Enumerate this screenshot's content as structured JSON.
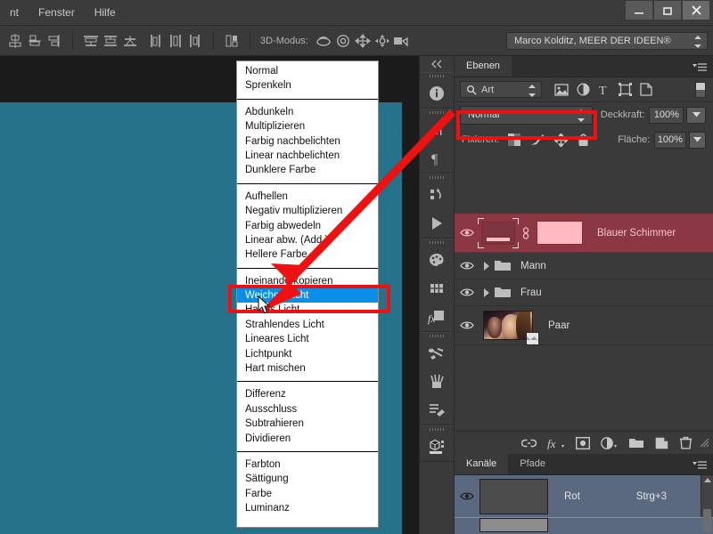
{
  "window": {
    "menu_items": [
      "nt",
      "Fenster",
      "Hilfe"
    ],
    "controls": {
      "minimize": "minimize-icon",
      "maximize": "maximize-icon",
      "close": "close-icon"
    }
  },
  "options_bar": {
    "align_icons": [
      "align-vertical-center-icon",
      "align-bottom-edges-icon",
      "distribute-top-edges-icon",
      "distribute-vertical-centers-icon",
      "distribute-bottom-edges-icon",
      "distribute-left-edges-icon",
      "distribute-horizontal-centers-icon",
      "distribute-right-edges-icon",
      "auto-align-layers-icon"
    ],
    "three_d_label": "3D-Modus:",
    "three_d_icons": [
      "orbit-3d-icon",
      "roll-3d-icon",
      "pan-3d-icon",
      "slide-3d-icon",
      "scale-3d-camera-icon"
    ],
    "preset_value": "Marco Kolditz, MEER DER IDEEN®"
  },
  "blend_dropdown": {
    "groups": [
      {
        "items": [
          "Normal",
          "Sprenkeln"
        ]
      },
      {
        "items": [
          "Abdunkeln",
          "Multiplizieren",
          "Farbig nachbelichten",
          "Linear nachbelichten",
          "Dunklere Farbe"
        ]
      },
      {
        "items": [
          "Aufhellen",
          "Negativ multiplizieren",
          "Farbig abwedeln",
          "Linear abw. (Add.)",
          "Hellere Farbe"
        ]
      },
      {
        "items": [
          "Ineinanderkopieren",
          "Weiches Licht",
          "Hartes Licht",
          "Strahlendes Licht",
          "Lineares Licht",
          "Lichtpunkt",
          "Hart mischen"
        ]
      },
      {
        "items": [
          "Differenz",
          "Ausschluss",
          "Subtrahieren",
          "Dividieren"
        ]
      },
      {
        "items": [
          "Farbton",
          "Sättigung",
          "Farbe",
          "Luminanz"
        ]
      }
    ],
    "highlighted": "Weiches Licht"
  },
  "dock": {
    "icons": [
      "collapse-panels-icon",
      "info-icon",
      "character-icon",
      "paragraph-icon",
      "layer-comps-icon",
      "timeline-icon",
      "color-icon",
      "swatches-icon",
      "styles-icon",
      "brush-presets-icon",
      "brushes-icon",
      "tool-presets-icon",
      "3d-icon"
    ]
  },
  "layers_panel": {
    "tabs": [
      {
        "label": "Ebenen",
        "active": true
      }
    ],
    "filter": {
      "search_icon": "search-icon",
      "kind_label": "Art",
      "type_filter_icons": [
        "pixel-filter-icon",
        "adjustment-filter-icon",
        "type-filter-icon",
        "shape-filter-icon",
        "smartobject-filter-icon"
      ],
      "toggle": "filter-enable-toggle"
    },
    "blend_mode": "Normal",
    "opacity_label": "Deckkraft:",
    "opacity_value": "100%",
    "lock_label": "Fixieren:",
    "lock_icons": [
      "lock-transparency-icon",
      "lock-image-icon",
      "lock-position-icon",
      "lock-all-icon"
    ],
    "fill_label": "Fläche:",
    "fill_value": "100%",
    "rows": [
      {
        "name": "Blauer Schimmer",
        "type": "layer-with-mask",
        "selected": true,
        "visible": true
      },
      {
        "name": "Mann",
        "type": "group",
        "selected": false,
        "visible": true
      },
      {
        "name": "Frau",
        "type": "group",
        "selected": false,
        "visible": true
      },
      {
        "name": "Paar",
        "type": "smart-object",
        "selected": false,
        "visible": true
      }
    ],
    "footer_icons": [
      "link-layers-icon",
      "layer-style-fx-icon",
      "add-mask-icon",
      "adjustment-layer-icon",
      "new-group-icon",
      "new-layer-icon",
      "delete-layer-icon"
    ]
  },
  "channels_panel": {
    "tabs": [
      {
        "label": "Kanäle",
        "active": true
      },
      {
        "label": "Pfade",
        "active": false
      }
    ],
    "rows": [
      {
        "name": "Rot",
        "shortcut": "Strg+3",
        "visible": true
      }
    ]
  },
  "annotations": {
    "highlight_boxes": [
      "blend-mode-select-box",
      "weiches-licht-item-box"
    ],
    "arrow": "red-arrow-pointing-to-weiches-licht",
    "color": "#ee1111"
  },
  "cursors": {
    "menu_pointer": "arrow-cursor",
    "layer_hand": "hand-cursor"
  }
}
